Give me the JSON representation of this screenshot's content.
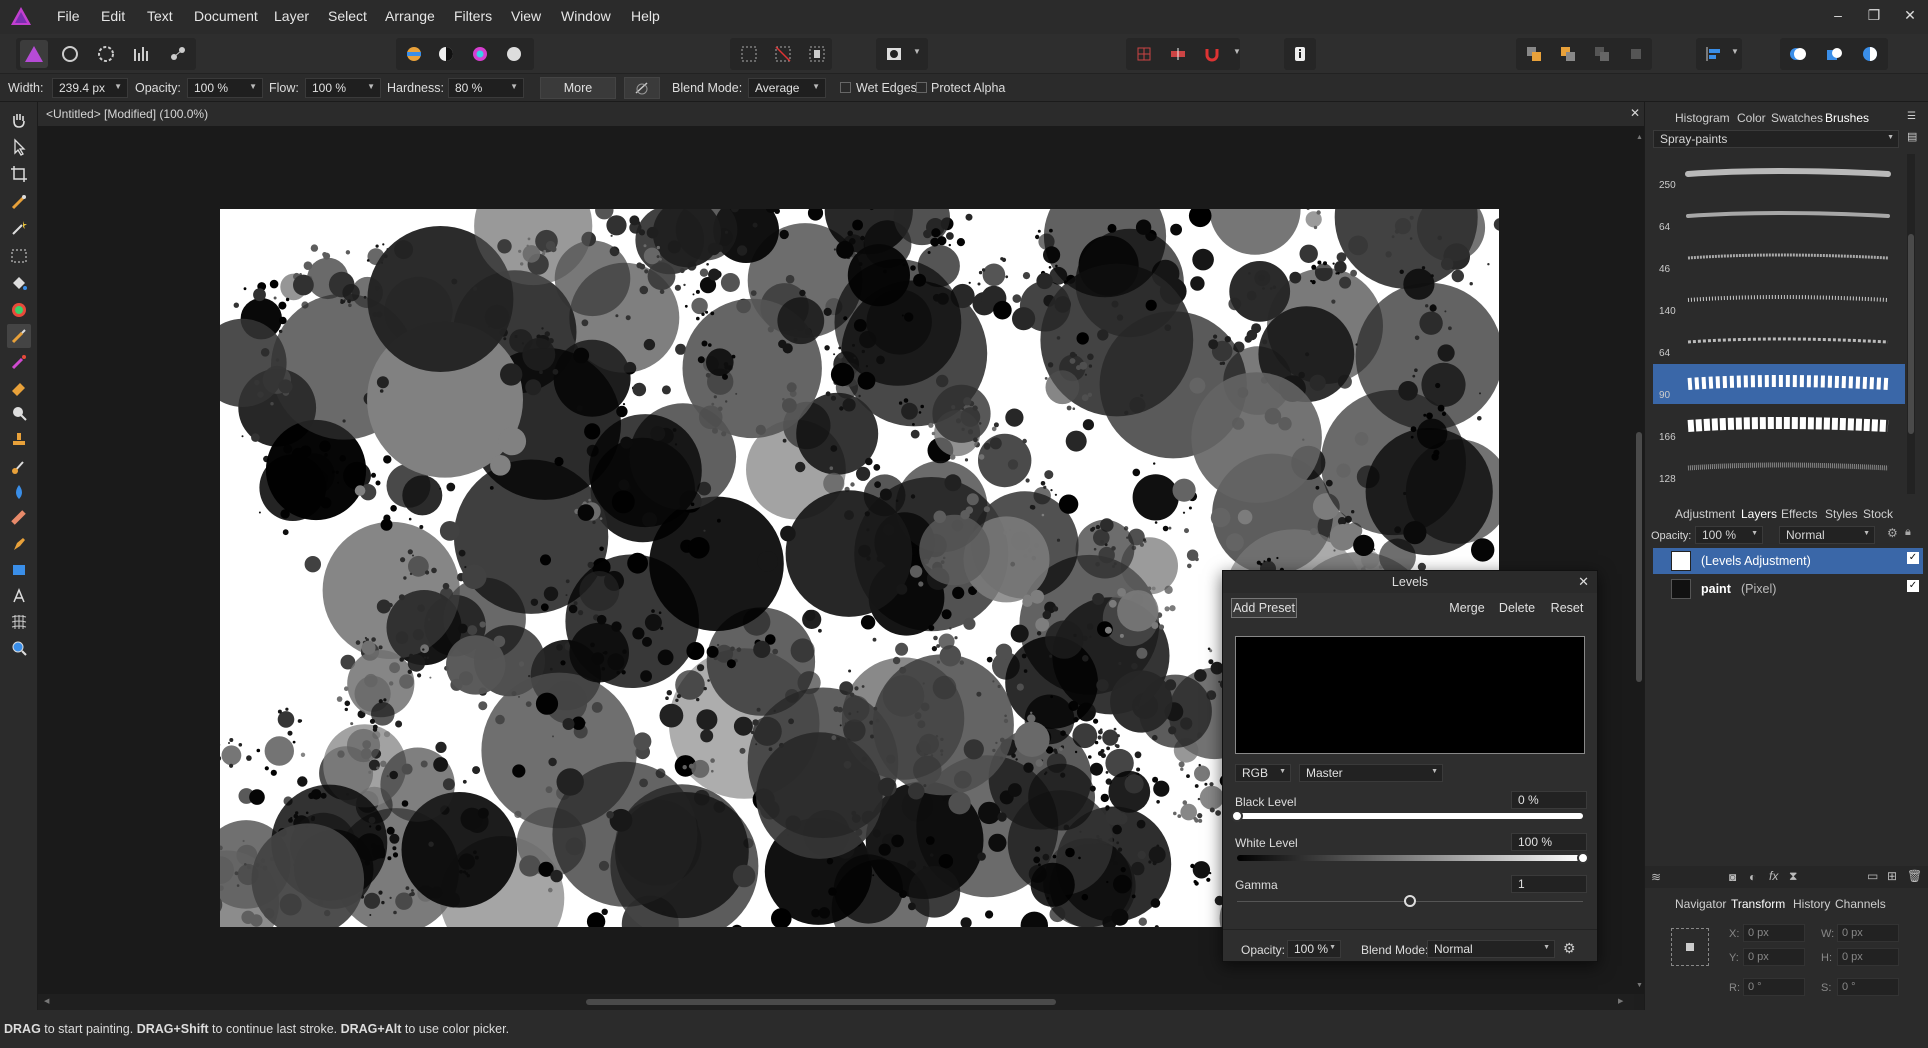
{
  "menu": [
    "File",
    "Edit",
    "Text",
    "Document",
    "Layer",
    "Select",
    "Arrange",
    "Filters",
    "View",
    "Window",
    "Help"
  ],
  "window_controls": [
    "–",
    "❐",
    "✕"
  ],
  "context": {
    "width_label": "Width:",
    "width_value": "239.4 px",
    "opacity_label": "Opacity:",
    "opacity_value": "100 %",
    "flow_label": "Flow:",
    "flow_value": "100 %",
    "hardness_label": "Hardness:",
    "hardness_value": "80 %",
    "more_label": "More",
    "blend_label": "Blend Mode:",
    "blend_value": "Average",
    "wet_edges": "Wet Edges",
    "protect_alpha": "Protect Alpha"
  },
  "document": {
    "title": "<Untitled> [Modified] (100.0%)",
    "close": "✕"
  },
  "brush_panel": {
    "tabs": [
      "Histogram",
      "Color",
      "Swatches",
      "Brushes"
    ],
    "category": "Spray-paints",
    "sizes": [
      "250",
      "64",
      "46",
      "140",
      "64",
      "90",
      "166",
      "128"
    ]
  },
  "layers_panel": {
    "tabs": [
      "Adjustment",
      "Layers",
      "Effects",
      "Styles",
      "Stock"
    ],
    "opacity_label": "Opacity:",
    "opacity_value": "100 %",
    "blend_value": "Normal",
    "layers": [
      {
        "name": "(Levels Adjustment)",
        "kind": ""
      },
      {
        "name": "paint",
        "kind": "(Pixel)"
      }
    ]
  },
  "transform_panel": {
    "tabs": [
      "Navigator",
      "Transform",
      "History",
      "Channels"
    ],
    "x_label": "X:",
    "x_value": "0 px",
    "y_label": "Y:",
    "y_value": "0 px",
    "w_label": "W:",
    "w_value": "0 px",
    "h_label": "H:",
    "h_value": "0 px",
    "r_label": "R:",
    "r_value": "0 °",
    "s_label": "S:",
    "s_value": "0 °"
  },
  "levels": {
    "title": "Levels",
    "add_preset": "Add Preset",
    "merge": "Merge",
    "delete": "Delete",
    "reset": "Reset",
    "channel": "RGB",
    "mode": "Master",
    "black_label": "Black Level",
    "black_value": "0 %",
    "white_label": "White Level",
    "white_value": "100 %",
    "gamma_label": "Gamma",
    "gamma_value": "1",
    "opacity_label": "Opacity:",
    "opacity_value": "100 %",
    "blend_label": "Blend Mode:",
    "blend_value": "Normal",
    "black_level": 0.0,
    "white_level": 1.0,
    "gamma_position": 0.5
  },
  "status": {
    "a": "DRAG",
    "b": " to start painting. ",
    "c": "DRAG+Shift",
    "d": " to continue last stroke. ",
    "e": "DRAG+Alt",
    "f": " to use color picker."
  },
  "colors": {
    "accent": "#3a67a8",
    "panel": "#2b2b2b",
    "canvas_bg": "#1a1a1a"
  }
}
